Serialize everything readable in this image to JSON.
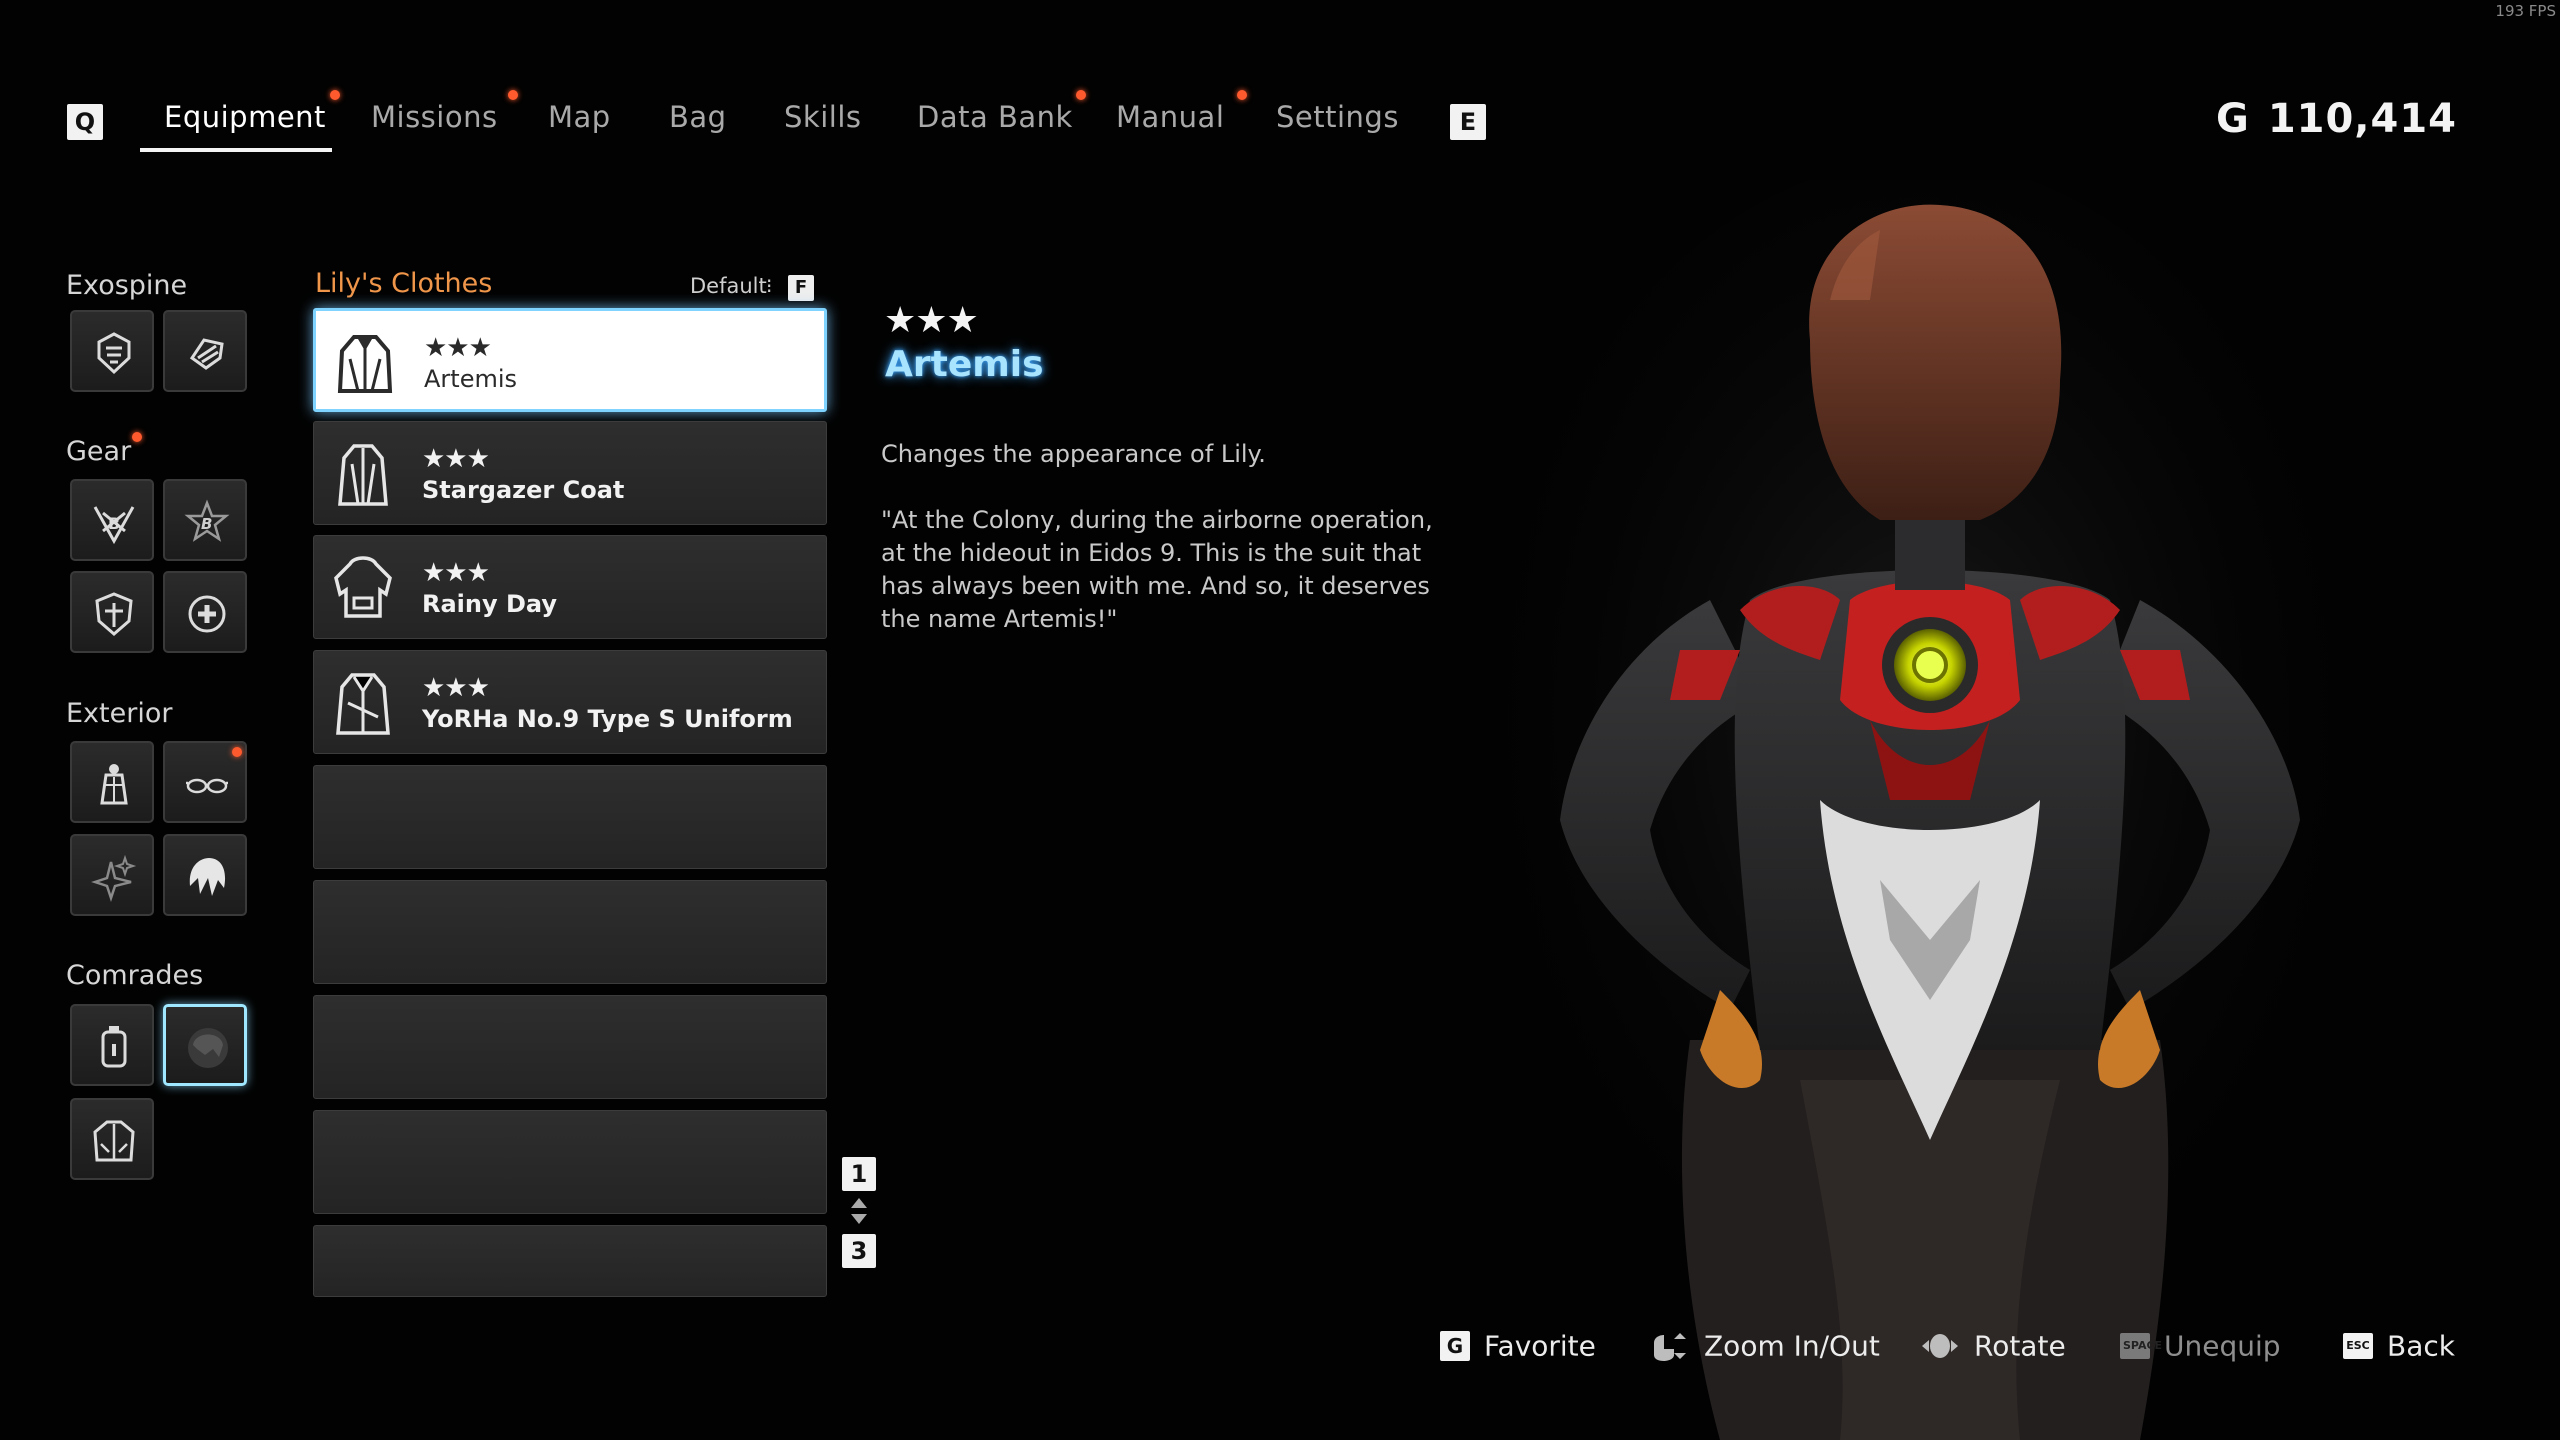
{
  "fps": "193 FPS",
  "nav": {
    "left_key": "Q",
    "right_key": "E",
    "tabs": [
      {
        "label": "Equipment",
        "active": true,
        "notify": true
      },
      {
        "label": "Missions",
        "active": false,
        "notify": true
      },
      {
        "label": "Map",
        "active": false,
        "notify": false
      },
      {
        "label": "Bag",
        "active": false,
        "notify": false
      },
      {
        "label": "Skills",
        "active": false,
        "notify": false
      },
      {
        "label": "Data Bank",
        "active": false,
        "notify": true
      },
      {
        "label": "Manual",
        "active": false,
        "notify": true
      },
      {
        "label": "Settings",
        "active": false,
        "notify": false
      }
    ]
  },
  "currency": {
    "symbol": "G",
    "amount": "110,414"
  },
  "categories": {
    "exospine": "Exospine",
    "gear": "Gear",
    "exterior": "Exterior",
    "comrades": "Comrades"
  },
  "list": {
    "title": "Lily's Clothes",
    "sort_label": "Default",
    "sort_key": "F",
    "items": [
      {
        "stars": "★★★",
        "name": "Artemis",
        "selected": true
      },
      {
        "stars": "★★★",
        "name": "Stargazer Coat",
        "selected": false
      },
      {
        "stars": "★★★",
        "name": "Rainy Day",
        "selected": false
      },
      {
        "stars": "★★★",
        "name": "YoRHa No.9 Type S Uniform",
        "selected": false
      }
    ],
    "page_current": "1",
    "page_total": "3"
  },
  "detail": {
    "stars": "★★★",
    "name": "Artemis",
    "description": "Changes the appearance of Lily.",
    "quote": "\"At the Colony, during the airborne operation, at the hideout in Eidos 9. This is the suit that has always been with me. And so, it deserves the name Artemis!\""
  },
  "prompts": {
    "favorite": {
      "key": "G",
      "label": "Favorite"
    },
    "zoom": {
      "label": "Zoom In/Out"
    },
    "rotate": {
      "label": "Rotate"
    },
    "unequip": {
      "key": "SPACE",
      "label": "Unequip"
    },
    "back": {
      "key": "ESC",
      "label": "Back"
    }
  },
  "colors": {
    "accent_orange": "#f0964a",
    "accent_blue": "#a9e4ff",
    "notify_red": "#ff5a2e"
  }
}
